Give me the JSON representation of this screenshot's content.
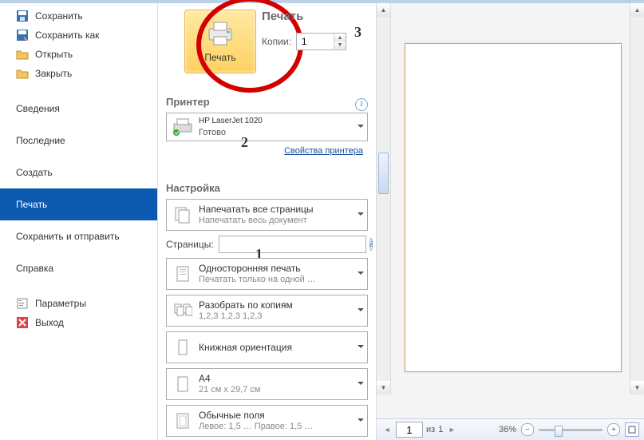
{
  "sidebar": {
    "items_top": [
      {
        "label": "Сохранить",
        "icon": "save"
      },
      {
        "label": "Сохранить как",
        "icon": "save-as"
      },
      {
        "label": "Открыть",
        "icon": "open"
      },
      {
        "label": "Закрыть",
        "icon": "close"
      }
    ],
    "items_main": [
      {
        "label": "Сведения"
      },
      {
        "label": "Последние"
      },
      {
        "label": "Создать"
      },
      {
        "label": "Печать",
        "active": true
      },
      {
        "label": "Сохранить и отправить"
      },
      {
        "label": "Справка"
      }
    ],
    "items_bottom": [
      {
        "label": "Параметры",
        "icon": "options"
      },
      {
        "label": "Выход",
        "icon": "exit"
      }
    ]
  },
  "print": {
    "header_title": "Печать",
    "button_label": "Печать",
    "copies_label": "Копии:",
    "copies_value": "1",
    "printer_section": "Принтер",
    "printer_name": "HP LaserJet 1020",
    "printer_status": "Готово",
    "printer_props_link": "Свойства принтера",
    "settings_section": "Настройка",
    "pages_label": "Страницы:",
    "pages_value": "",
    "options": [
      {
        "title": "Напечатать все страницы",
        "sub": "Напечатать весь документ",
        "icon": "all-pages"
      },
      {
        "title": "Односторонняя печать",
        "sub": "Печатать только на одной …",
        "icon": "one-side"
      },
      {
        "title": "Разобрать по копиям",
        "sub": "1,2,3   1,2,3   1,2,3",
        "icon": "collate"
      },
      {
        "title": "Книжная ориентация",
        "sub": "",
        "icon": "portrait"
      },
      {
        "title": "A4",
        "sub": "21 см x 29,7 см",
        "icon": "paper"
      },
      {
        "title": "Обычные поля",
        "sub": "Левое: 1,5 …   Правое: 1,5 …",
        "icon": "margins"
      }
    ]
  },
  "annotations": {
    "a1": "1",
    "a2": "2",
    "a3": "3"
  },
  "status": {
    "page_current": "1",
    "page_sep": "из",
    "page_total": "1",
    "zoom": "36%"
  }
}
